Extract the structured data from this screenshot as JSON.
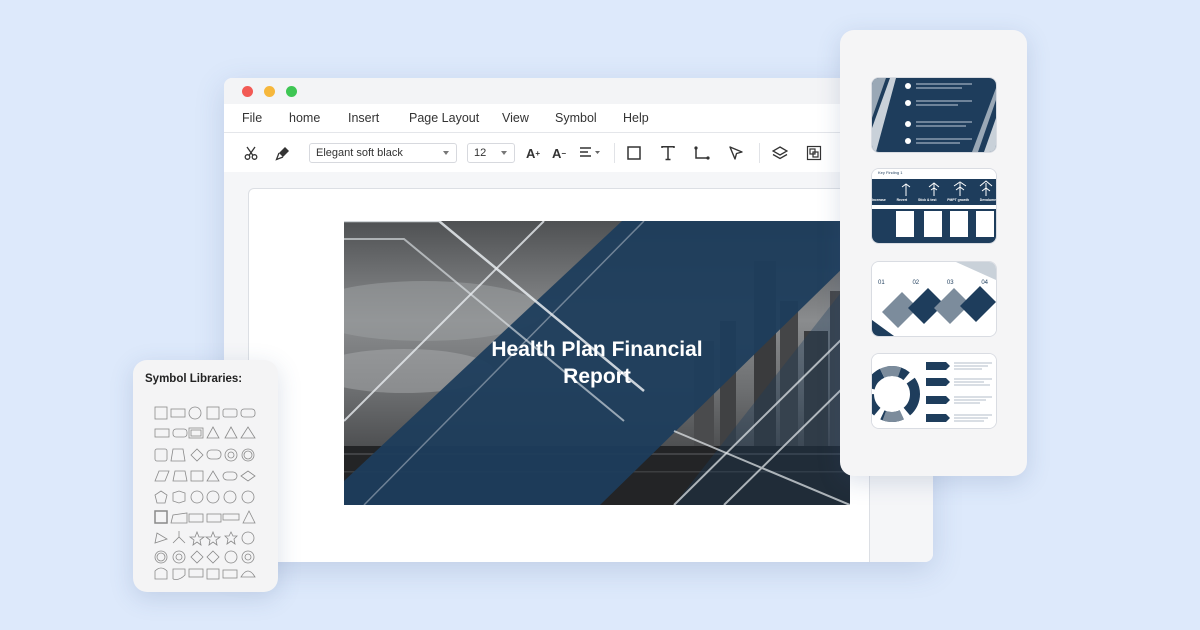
{
  "window": {
    "menu": [
      "File",
      "home",
      "Insert",
      "Page Layout",
      "View",
      "Symbol",
      "Help"
    ],
    "toolbar": {
      "font_family": "Elegant soft black",
      "font_size": "12"
    }
  },
  "slide": {
    "title": "Health Plan Financial Report"
  },
  "symbol_library": {
    "title": "Symbol Libraries:"
  },
  "templates": [
    {
      "name": "template-thumb-1"
    },
    {
      "name": "template-thumb-2",
      "header": "Key Finding 1",
      "labels": [
        "Increase",
        "Revert",
        "Stick & test",
        "PMPT growth",
        "Devolume"
      ]
    },
    {
      "name": "template-thumb-3",
      "labels": [
        "01",
        "02",
        "03",
        "04"
      ]
    },
    {
      "name": "template-thumb-4"
    }
  ],
  "colors": {
    "background": "#dde9fb",
    "slide_navy": "#1e3d5c",
    "accent_gray": "#7c8c9c"
  }
}
